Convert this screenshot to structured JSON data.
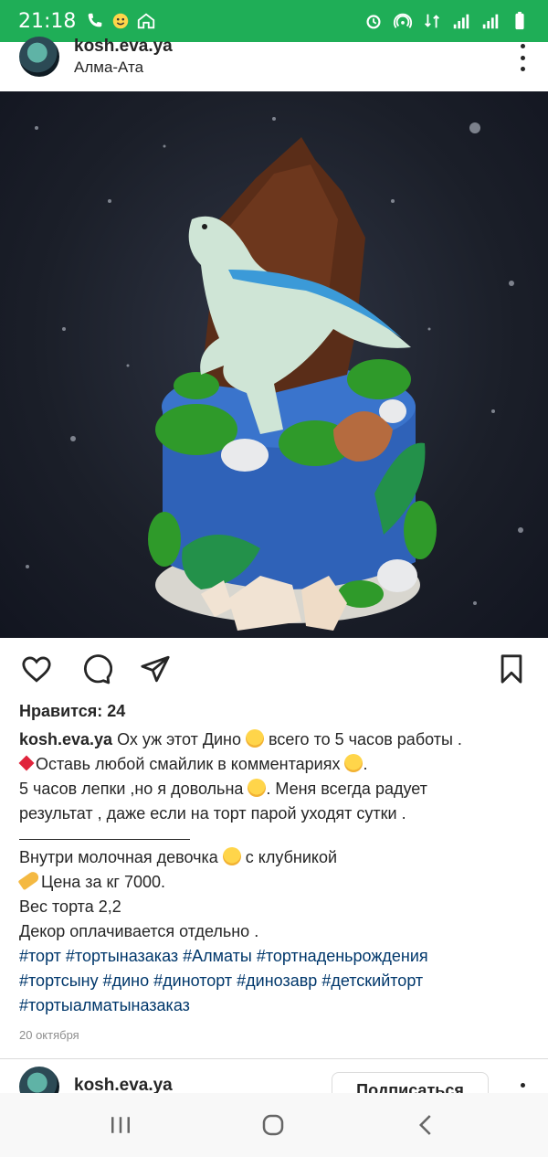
{
  "status_bar": {
    "time": "21:18",
    "left_icons": [
      "call-icon",
      "emoji-notification-icon",
      "home-icon"
    ],
    "right_icons": [
      "alarm-icon",
      "hotspot-icon",
      "data-icon",
      "signal-icon",
      "signal2-icon",
      "battery-icon"
    ],
    "bg_color": "#1fae57"
  },
  "post": {
    "username": "kosh.eva.ya",
    "location": "Алма-Ата",
    "likes": "Нравится: 24",
    "caption": {
      "user": "kosh.eva.ya",
      "line1_text": " Ох уж этот Дино ",
      "line1_text2": " всего то 5 часов работы .",
      "line2_text": "Оставь любой смайлик в комментариях ",
      "line2_text2": ".",
      "line3_text": "5 часов лепки ,но я довольна ",
      "line3_text2": ". Меня всегда радует",
      "line4_text": "результат , даже если на торт парой уходят сутки .",
      "line5_text": "Внутри молочная девочка ",
      "line5_text2": " с клубникой",
      "line6_text": "Цена за кг 7000.",
      "line7_text": "Вес торта 2,2",
      "line8_text": "Декор оплачивается отдельно .",
      "tags_line1": "#торт #тортыназаказ #Алматы #тортнаденьрождения",
      "tags_line2": "#тортсыну #дино #диноторт #динозавр #детскийторт",
      "tags_line3": "#тортыалматыназаказ"
    },
    "date": "20 октября",
    "link_color": "#00376b"
  },
  "next_post": {
    "username": "kosh.eva.ya",
    "follow_label": "Подписаться"
  }
}
